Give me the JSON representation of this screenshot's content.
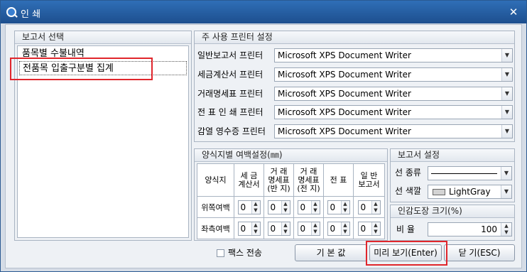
{
  "window": {
    "title": "인 쇄",
    "close_glyph": "✕"
  },
  "report_select": {
    "title": "보고서 선택",
    "items": [
      "품목별 수불내역",
      "전품목 입출구분별 집계"
    ],
    "selected_index": 1
  },
  "printer_settings": {
    "title": "주 사용 프린터 설정",
    "rows": [
      {
        "label": "일반보고서 프린터",
        "value": "Microsoft XPS Document Writer"
      },
      {
        "label": "세금계산서 프린터",
        "value": "Microsoft XPS Document Writer"
      },
      {
        "label": "거래명세표 프린터",
        "value": "Microsoft XPS Document Writer"
      },
      {
        "label": "전 표 인 쇄 프린터",
        "value": "Microsoft XPS Document Writer"
      },
      {
        "label": "감열 영수증 프린터",
        "value": "Microsoft XPS Document Writer"
      }
    ]
  },
  "margin_settings": {
    "title": "양식지별 여백설정(㎜)",
    "corner_label": "양식지",
    "columns": [
      {
        "l1": "세 금",
        "l2": "계산서"
      },
      {
        "l1": "거 래",
        "l2": "명세표",
        "l3": "(반 지)"
      },
      {
        "l1": "거 래",
        "l2": "명세표",
        "l3": "(전 지)"
      },
      {
        "l1": "전 표",
        "l2": ""
      },
      {
        "l1": "일 반",
        "l2": "보고서"
      }
    ],
    "rows": [
      {
        "label": "위쪽여백",
        "values": [
          "0",
          "0",
          "0",
          "0",
          "0"
        ]
      },
      {
        "label": "좌측여백",
        "values": [
          "0",
          "0",
          "0",
          "0",
          "0"
        ]
      }
    ]
  },
  "report_settings": {
    "title": "보고서 설정",
    "line_type_label": "선 종류",
    "line_color_label": "선 색깔",
    "line_color_value": "LightGray"
  },
  "stamp_settings": {
    "title": "인감도장 크기(%)",
    "ratio_label": "비  율",
    "ratio_value": "100"
  },
  "footer": {
    "fax_label": "팩스 전송",
    "default_button": "기 본 값",
    "preview_button": "미리 보기(Enter)",
    "close_button": "닫  기(ESC)"
  },
  "colors": {
    "highlight": "#e0262c",
    "titlebar": "#1d4f8e"
  }
}
